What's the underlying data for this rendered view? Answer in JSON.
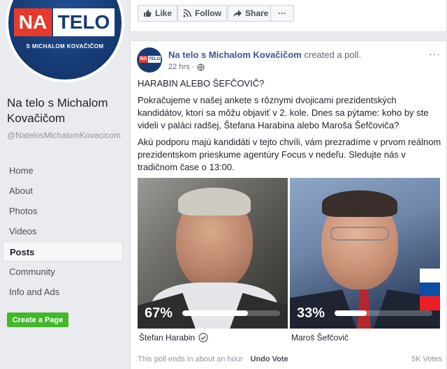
{
  "page": {
    "logo_na": "NA",
    "logo_telo": "TELO",
    "logo_sub": "S MICHALOM KOVAČIČOM",
    "name": "Na telo s Michalom Kovačičom",
    "handle": "@NatelosMichalomKovacicom"
  },
  "nav": {
    "items": [
      {
        "label": "Home"
      },
      {
        "label": "About"
      },
      {
        "label": "Photos"
      },
      {
        "label": "Videos"
      },
      {
        "label": "Posts",
        "active": true
      },
      {
        "label": "Community"
      },
      {
        "label": "Info and Ads"
      }
    ]
  },
  "create_page_label": "Create a Page",
  "actions": {
    "like": "Like",
    "follow": "Follow",
    "share": "Share",
    "more": "···"
  },
  "post": {
    "author": "Na telo s Michalom Kovačičom",
    "action": "created a poll.",
    "time": "22 hrs",
    "menu": "···",
    "heading": "HARABIN ALEBO ŠEFČOVIČ?",
    "paragraph1": "Pokračujeme v našej ankete s rôznymi dvojicami prezidentských kandidátov, ktorí sa môžu objaviť v 2. kole. Dnes sa pýtame: koho by ste videli v paláci radšej, Štefana Harabina alebo Maroša Šefčoviča?",
    "paragraph2": "Akú podporu majú kandidáti v tejto chvíli, vám prezradíme v prvom reálnom prezidentskom prieskume agentúry Focus v nedeľu. Sledujte nás v tradičnom čase o 13:00."
  },
  "poll": {
    "options": [
      {
        "name": "Štefan Harabin",
        "percent_label": "67%",
        "share": 0.67,
        "voted": true
      },
      {
        "name": "Maroš Šefčovič",
        "percent_label": "33%",
        "share": 0.33,
        "voted": false
      }
    ],
    "ends_text": "This poll ends in about an hour",
    "undo_label": "Undo Vote",
    "votes": "5K Votes"
  },
  "colors": {
    "link": "#365899",
    "green_button": "#42b72a",
    "brand_red": "#e63a2d",
    "brand_blue": "#163b74"
  }
}
